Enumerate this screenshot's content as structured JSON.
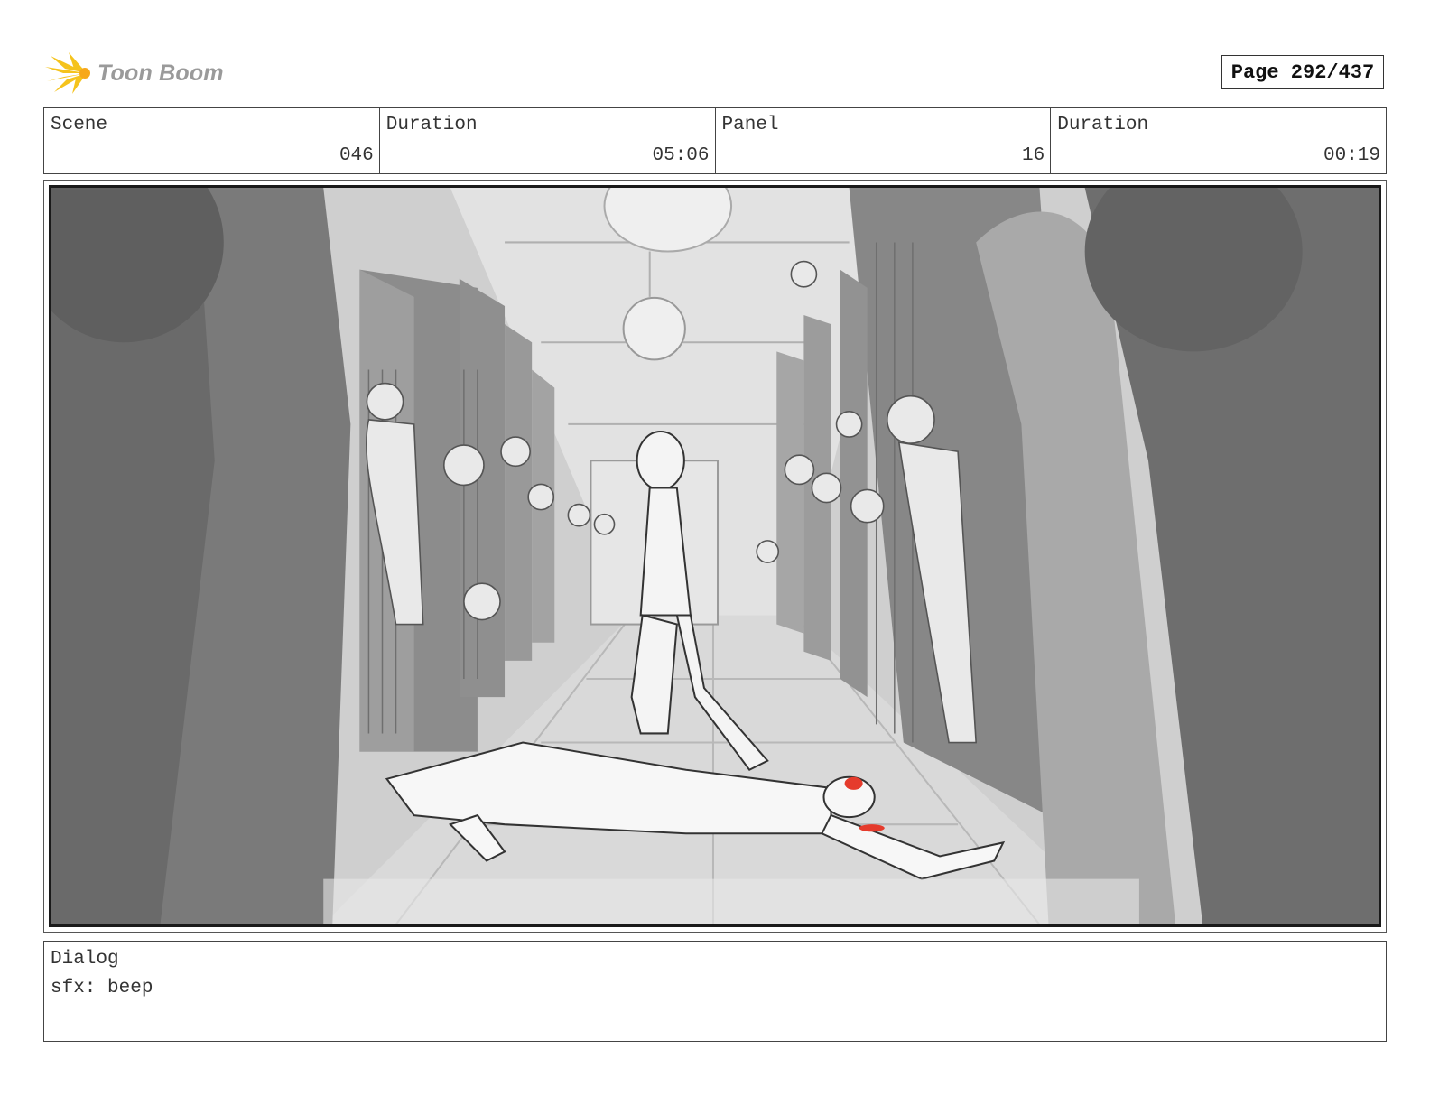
{
  "header": {
    "logo_icon": "starburst-icon",
    "logo_text": "Toon Boom",
    "page_label": "Page 292/437"
  },
  "info": {
    "scene_label": "Scene",
    "scene_value": "046",
    "scene_duration_label": "Duration",
    "scene_duration_value": "05:06",
    "panel_label": "Panel",
    "panel_value": "16",
    "panel_duration_label": "Duration",
    "panel_duration_value": "00:19"
  },
  "dialog": {
    "label": "Dialog",
    "text": "sfx: beep"
  },
  "colors": {
    "logo_yellow": "#f5c31c",
    "frame_green": "#2f7d32",
    "blood_red": "#e53b2c"
  }
}
